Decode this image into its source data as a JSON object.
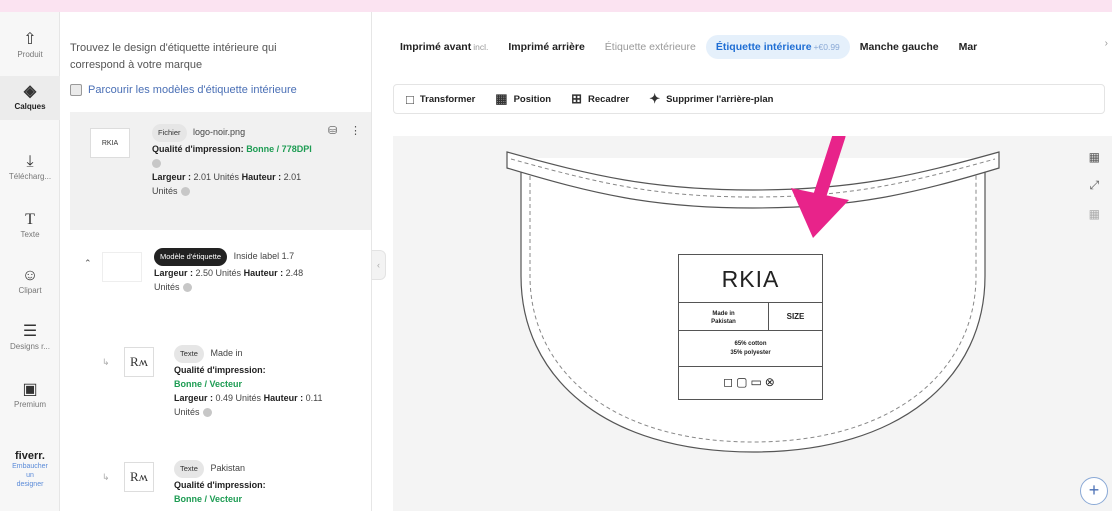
{
  "rail": {
    "items": [
      {
        "label": "Produit",
        "icon": "shirt-icon"
      },
      {
        "label": "Calques",
        "icon": "layers-icon"
      },
      {
        "label": "Télécharg...",
        "icon": "upload-icon"
      },
      {
        "label": "Texte",
        "icon": "text-icon"
      },
      {
        "label": "Clipart",
        "icon": "smiley-icon"
      },
      {
        "label": "Designs r...",
        "icon": "designs-icon"
      },
      {
        "label": "Premium",
        "icon": "premium-icon"
      }
    ],
    "fiverr": {
      "logo": "fiverr.",
      "line1": "Embaucher",
      "line2": "un",
      "line3": "designer"
    }
  },
  "panel": {
    "intro": "Trouvez le design d'étiquette intérieure qui correspond à votre marque",
    "browse_link": "Parcourir les modèles d'étiquette intérieure",
    "layers": [
      {
        "tag": "Fichier",
        "name": "logo-noir.png",
        "quality_label": "Qualité d'impression:",
        "quality_value": "Bonne / 778DPI",
        "width_label": "Largeur :",
        "width_value": "2.01 Unités",
        "height_label": "Hauteur :",
        "height_value": "2.01",
        "units": "Unités",
        "thumb": "RKIA"
      },
      {
        "tag": "Modèle d'étiquette",
        "name": "Inside label 1.7",
        "width_label": "Largeur :",
        "width_value": "2.50 Unités",
        "height_label": "Hauteur :",
        "height_value": "2.48",
        "units": "Unités"
      },
      {
        "tag": "Texte",
        "name": "Made in",
        "quality_label": "Qualité d'impression:",
        "quality_value": "Bonne / Vecteur",
        "width_label": "Largeur :",
        "width_value": "0.49 Unités",
        "height_label": "Hauteur :",
        "height_value": "0.11",
        "units": "Unités",
        "thumb": "Rʍ"
      },
      {
        "tag": "Texte",
        "name": "Pakistan",
        "quality_label": "Qualité d'impression:",
        "quality_value": "Bonne / Vecteur",
        "thumb": "Rʍ"
      }
    ]
  },
  "tabs": [
    {
      "label": "Imprimé avant",
      "extra": "incl."
    },
    {
      "label": "Imprimé arrière",
      "extra": ""
    },
    {
      "label": "Étiquette extérieure",
      "extra": ""
    },
    {
      "label": "Étiquette intérieure",
      "extra": "+€0.99"
    },
    {
      "label": "Manche gauche",
      "extra": ""
    },
    {
      "label": "Mar",
      "extra": ""
    }
  ],
  "toolbar": {
    "transform": "Transformer",
    "position": "Position",
    "crop": "Recadrer",
    "remove_bg": "Supprimer l'arrière-plan"
  },
  "label": {
    "brand": "RKIA",
    "made_in_1": "Made in",
    "made_in_2": "Pakistan",
    "size": "SIZE",
    "comp_1": "65% cotton",
    "comp_2": "35% polyester",
    "care_symbols": "◻▢▭⊗"
  },
  "colors": {
    "accent": "#1f6ed4",
    "arrow": "#e8238a",
    "good": "#1d9c53",
    "background": "#fbe3f1"
  }
}
